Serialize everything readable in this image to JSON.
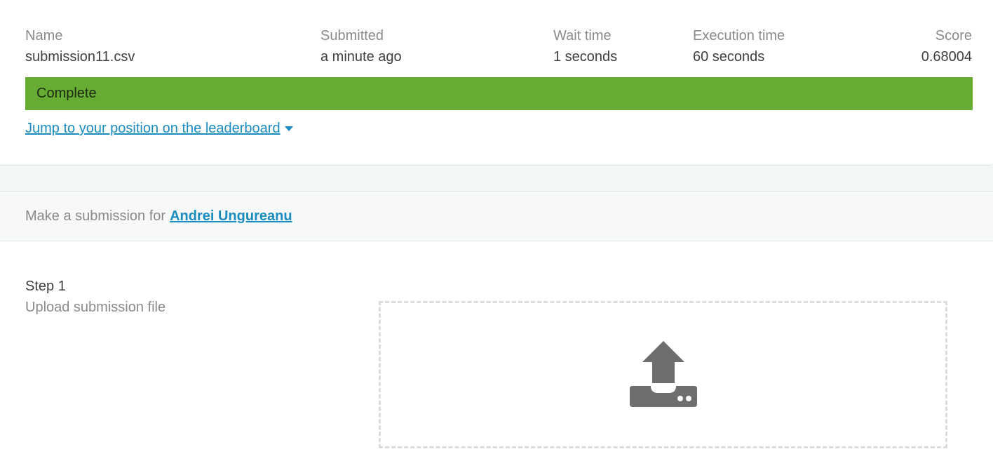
{
  "result": {
    "columns": [
      {
        "label": "Name",
        "value": "submission11.csv"
      },
      {
        "label": "Submitted",
        "value": "a minute ago"
      },
      {
        "label": "Wait time",
        "value": "1 seconds"
      },
      {
        "label": "Execution time",
        "value": "60 seconds"
      },
      {
        "label": "Score",
        "value": "0.68004"
      }
    ],
    "status": "Complete",
    "status_color": "#66ac33",
    "jump_link": "Jump to your position on the leaderboard"
  },
  "submission": {
    "header_prefix": "Make a submission for",
    "user_link": "Andrei Ungureanu",
    "step_title": "Step 1",
    "step_subtitle": "Upload submission file",
    "upload_icon": "upload-icon"
  },
  "colors": {
    "link": "#1a8cbf",
    "icon": "#6e6e70"
  }
}
